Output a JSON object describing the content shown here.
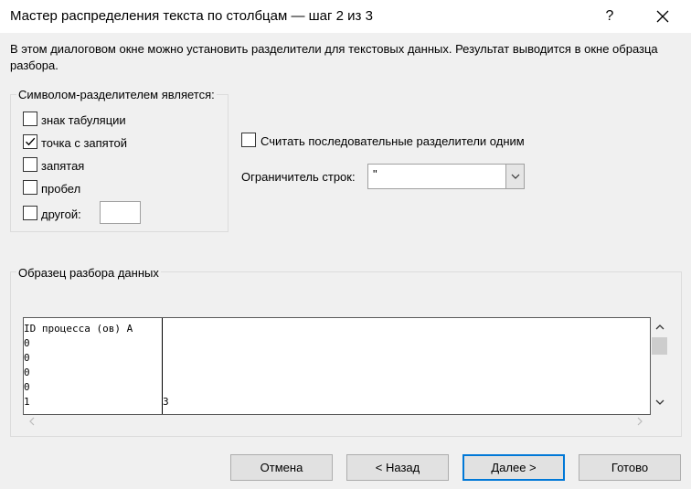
{
  "window": {
    "title": "Мастер распределения текста по столбцам — шаг 2 из 3",
    "help_label": "?",
    "close_icon": "close-icon"
  },
  "description": "В этом диалоговом окне можно установить разделители для текстовых данных. Результат выводится в окне образца разбора.",
  "delimiters": {
    "legend": "Символом-разделителем является:",
    "tab": {
      "label": "знак табуляции",
      "checked": false
    },
    "semicolon": {
      "label": "точка с запятой",
      "checked": true
    },
    "comma": {
      "label": "запятая",
      "checked": false
    },
    "space": {
      "label": "пробел",
      "checked": false
    },
    "other": {
      "label": "другой:",
      "checked": false,
      "value": ""
    }
  },
  "consecutive": {
    "label": "Считать последовательные разделители одним",
    "checked": false
  },
  "qualifier": {
    "label": "Ограничитель строк:",
    "value": "\""
  },
  "preview": {
    "legend": "Образец разбора данных",
    "column1": [
      "ID процесса (ов) A",
      "0",
      "0",
      "0",
      "0",
      "1"
    ],
    "column2": [
      "",
      "",
      "",
      "",
      "",
      "3"
    ]
  },
  "buttons": {
    "cancel": "Отмена",
    "back": "< Назад",
    "next": "Далее >",
    "finish": "Готово"
  },
  "colors": {
    "accent": "#0078d7",
    "background": "#f0f0f0"
  }
}
